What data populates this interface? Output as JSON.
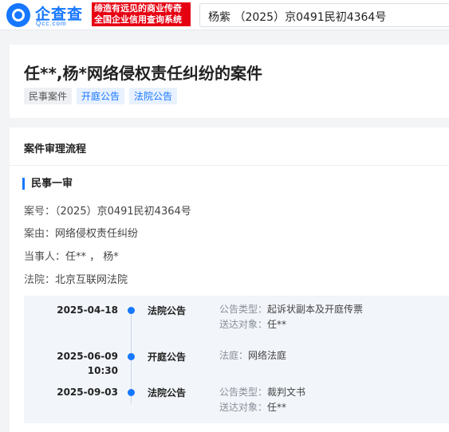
{
  "header": {
    "logo_text": "企查查",
    "logo_sub": "Qcc.com",
    "slogan_line1": "缔造有远见的商业传奇",
    "slogan_line2": "全国企业信用查询系统",
    "search_value": "杨紫 （2025）京0491民初4364号"
  },
  "case": {
    "title": "任**,杨*网络侵权责任纠纷的案件",
    "tags": [
      "民事案件",
      "开庭公告",
      "法院公告"
    ]
  },
  "process": {
    "section_title": "案件审理流程",
    "stage_title": "民事一审",
    "case_no_label": "案号：",
    "case_no": "（2025）京0491民初4364号",
    "cause_label": "案由：",
    "cause": "网络侵权责任纠纷",
    "parties_label": "当事人：",
    "parties": "任** ，  杨*",
    "court_label": "法院：",
    "court": "北京互联网法院"
  },
  "timeline": [
    {
      "date": "2025-04-18",
      "time": "",
      "type": "法院公告",
      "details": [
        {
          "k": "公告类型：",
          "v": "起诉状副本及开庭传票"
        },
        {
          "k": "送达对象：",
          "v": "任**"
        }
      ]
    },
    {
      "date": "2025-06-09",
      "time": "10:30",
      "type": "开庭公告",
      "details": [
        {
          "k": "法庭：",
          "v": "网络法庭"
        }
      ]
    },
    {
      "date": "2025-09-03",
      "time": "",
      "type": "法院公告",
      "details": [
        {
          "k": "公告类型：",
          "v": "裁判文书"
        },
        {
          "k": "送达对象：",
          "v": "任**"
        }
      ]
    }
  ],
  "colors": {
    "brand": "#1677ff",
    "slogan_bg": "#e60012"
  }
}
